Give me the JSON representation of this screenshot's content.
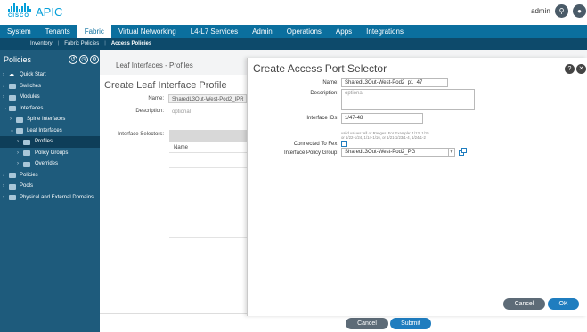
{
  "header": {
    "logo_text": "CISCO",
    "app_title": "APIC",
    "user": "admin",
    "search_icon": "search-icon",
    "alert_icon": "bell-icon"
  },
  "main_tabs": [
    {
      "label": "System"
    },
    {
      "label": "Tenants"
    },
    {
      "label": "Fabric"
    },
    {
      "label": "Virtual Networking"
    },
    {
      "label": "L4-L7 Services"
    },
    {
      "label": "Admin"
    },
    {
      "label": "Operations"
    },
    {
      "label": "Apps"
    },
    {
      "label": "Integrations"
    }
  ],
  "sub_nav": [
    {
      "label": "Inventory"
    },
    {
      "label": "Fabric Policies"
    },
    {
      "label": "Access Policies"
    }
  ],
  "sidebar": {
    "title": "Policies",
    "items": [
      {
        "label": "Quick Start"
      },
      {
        "label": "Switches"
      },
      {
        "label": "Modules"
      },
      {
        "label": "Interfaces"
      },
      {
        "label": "Spine Interfaces"
      },
      {
        "label": "Leaf Interfaces"
      },
      {
        "label": "Profiles"
      },
      {
        "label": "Policy Groups"
      },
      {
        "label": "Overrides"
      },
      {
        "label": "Policies"
      },
      {
        "label": "Pools"
      },
      {
        "label": "Physical and External Domains"
      }
    ]
  },
  "profiles_panel": {
    "title": "Leaf Interfaces - Profiles"
  },
  "leaf_profile": {
    "title": "Create Leaf Interface Profile",
    "name_label": "Name:",
    "name_value": "SharedL3Out-West-Pod2_IPR",
    "description_label": "Description:",
    "description_placeholder": "optional",
    "selectors_label": "Interface Selectors:",
    "selectors_column": "Name"
  },
  "modal": {
    "title": "Create Access Port Selector",
    "help_icon": "help-icon",
    "close_icon": "close-icon",
    "name_label": "Name:",
    "name_value": "SharedL3Out-West-Pod2_p1_47",
    "description_label": "Description:",
    "description_placeholder": "optional",
    "ids_label": "Interface IDs:",
    "ids_value": "1/47-48",
    "ids_hint": "valid values: All or Ranges. For Example: 1/13, 1/15 or 1/22-1/24, 1/14-1/16, or 1/21-1/23/1-4, 1/24/1-2",
    "fex_label": "Connected To Fex:",
    "fex_checked": false,
    "policy_group_label": "Interface Policy Group:",
    "policy_group_value": "SharedL3Out-West-Pod2_PG",
    "cancel_label": "Cancel",
    "ok_label": "OK"
  },
  "footer": {
    "cancel_label": "Cancel",
    "submit_label": "Submit"
  }
}
